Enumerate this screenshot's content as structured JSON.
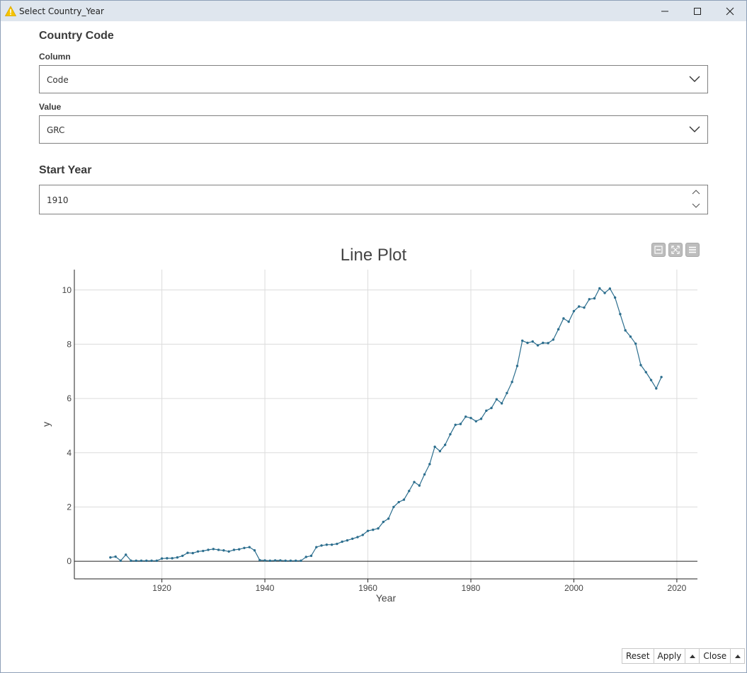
{
  "window": {
    "title": "Select Country_Year"
  },
  "country_code": {
    "heading": "Country Code",
    "column_label": "Column",
    "column_value": "Code",
    "value_label": "Value",
    "value_value": "GRC"
  },
  "start_year": {
    "heading": "Start Year",
    "value": "1910"
  },
  "footer": {
    "reset": "Reset",
    "apply": "Apply",
    "close": "Close"
  },
  "chart_data": {
    "type": "line",
    "title": "Line Plot",
    "xlabel": "Year",
    "ylabel": "y",
    "xlim": [
      1903,
      2024
    ],
    "ylim": [
      -0.65,
      10.75
    ],
    "xticks": [
      1920,
      1940,
      1960,
      1980,
      2000,
      2020
    ],
    "yticks": [
      0,
      2,
      4,
      6,
      8,
      10
    ],
    "grid": true,
    "color": "#2c6e8e",
    "x": [
      1910,
      1911,
      1912,
      1913,
      1914,
      1915,
      1916,
      1917,
      1918,
      1919,
      1920,
      1921,
      1922,
      1923,
      1924,
      1925,
      1926,
      1927,
      1928,
      1929,
      1930,
      1931,
      1932,
      1933,
      1934,
      1935,
      1936,
      1937,
      1938,
      1939,
      1940,
      1941,
      1942,
      1943,
      1944,
      1945,
      1946,
      1947,
      1948,
      1949,
      1950,
      1951,
      1952,
      1953,
      1954,
      1955,
      1956,
      1957,
      1958,
      1959,
      1960,
      1961,
      1962,
      1963,
      1964,
      1965,
      1966,
      1967,
      1968,
      1969,
      1970,
      1971,
      1972,
      1973,
      1974,
      1975,
      1976,
      1977,
      1978,
      1979,
      1980,
      1981,
      1982,
      1983,
      1984,
      1985,
      1986,
      1987,
      1988,
      1989,
      1990,
      1991,
      1992,
      1993,
      1994,
      1995,
      1996,
      1997,
      1998,
      1999,
      2000,
      2001,
      2002,
      2003,
      2004,
      2005,
      2006,
      2007,
      2008,
      2009,
      2010,
      2011,
      2012,
      2013,
      2014,
      2015,
      2016,
      2017
    ],
    "y": [
      0.14,
      0.17,
      0.02,
      0.24,
      0.02,
      0.02,
      0.02,
      0.02,
      0.02,
      0.02,
      0.1,
      0.11,
      0.11,
      0.14,
      0.2,
      0.31,
      0.3,
      0.36,
      0.38,
      0.42,
      0.45,
      0.42,
      0.4,
      0.36,
      0.42,
      0.44,
      0.49,
      0.52,
      0.4,
      0.04,
      0.03,
      0.02,
      0.03,
      0.03,
      0.02,
      0.02,
      0.02,
      0.02,
      0.16,
      0.2,
      0.52,
      0.58,
      0.61,
      0.61,
      0.64,
      0.72,
      0.77,
      0.83,
      0.89,
      0.97,
      1.12,
      1.16,
      1.21,
      1.45,
      1.57,
      2.0,
      2.18,
      2.27,
      2.59,
      2.92,
      2.79,
      3.2,
      3.58,
      4.22,
      4.06,
      4.29,
      4.68,
      5.03,
      5.06,
      5.33,
      5.28,
      5.16,
      5.25,
      5.55,
      5.65,
      5.97,
      5.82,
      6.2,
      6.61,
      7.2,
      8.13,
      8.05,
      8.1,
      7.96,
      8.05,
      8.04,
      8.17,
      8.55,
      8.95,
      8.83,
      9.22,
      9.39,
      9.35,
      9.66,
      9.69,
      10.06,
      9.89,
      10.05,
      9.72,
      9.11,
      8.51,
      8.28,
      8.02,
      7.23,
      6.97,
      6.68,
      6.37,
      6.79
    ]
  }
}
